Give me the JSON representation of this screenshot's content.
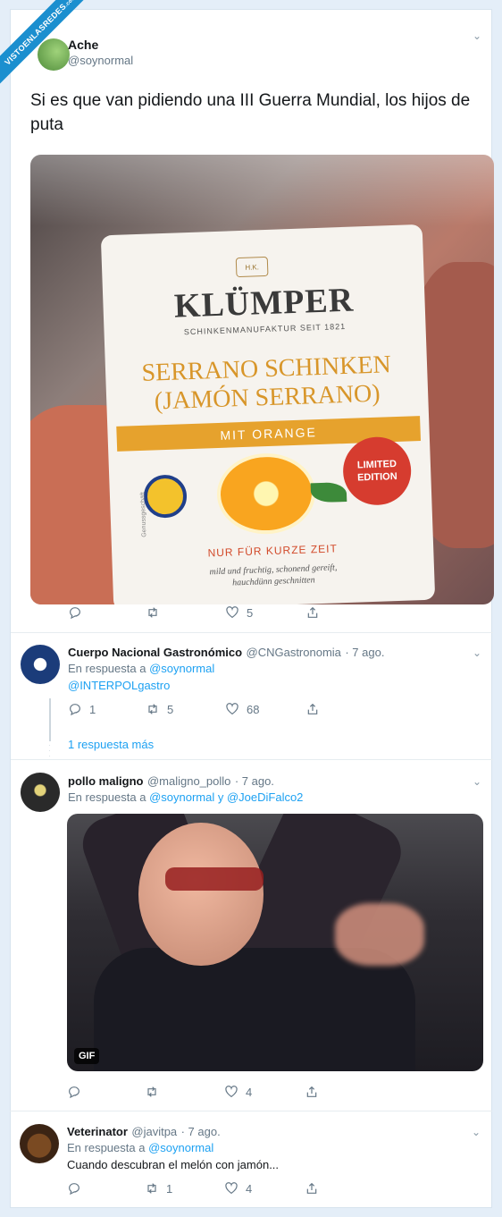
{
  "watermark": {
    "text": "VISTOENLASREDES",
    "sub": ".com"
  },
  "main_tweet": {
    "author_name": "Ache",
    "author_handle": "@soynormal",
    "text": "Si es que van pidiendo una III Guerra Mundial, los hijos de puta",
    "image": {
      "brand": "KLÜMPER",
      "crest": "H.K.",
      "subtitle": "SCHINKENMANUFAKTUR SEIT 1821",
      "title_line1": "SERRANO SCHINKEN",
      "title_line2": "(JAMÓN SERRANO)",
      "band": "MIT ORANGE",
      "badge_line1": "LIMITED",
      "badge_line2": "EDITION",
      "side_text": "Genussgeschäft",
      "nur": "NUR FÜR KURZE ZEIT",
      "mild_line1": "mild und fruchtig, schonend gereift,",
      "mild_line2": "hauchdünn geschnitten"
    },
    "likes": "5"
  },
  "replies": [
    {
      "name": "Cuerpo Nacional Gastronómico",
      "handle": "@CNGastronomia",
      "date": "· 7 ago.",
      "in_reply_prefix": "En respuesta a",
      "in_reply_to": "@soynormal",
      "text": "@INTERPOLgastro",
      "replies": "1",
      "retweets": "5",
      "likes": "68",
      "more": "1 respuesta más"
    },
    {
      "name": "pollo maligno",
      "handle": "@maligno_pollo",
      "date": "· 7 ago.",
      "in_reply_prefix": "En respuesta a",
      "in_reply_to": "@soynormal y @JoeDiFalco2",
      "gif_badge": "GIF",
      "likes": "4"
    },
    {
      "name": "Veterinator",
      "handle": "@javitpa",
      "date": "· 7 ago.",
      "in_reply_prefix": "En respuesta a",
      "in_reply_to": "@soynormal",
      "text": "Cuando descubran el melón con jamón...",
      "retweets": "1",
      "likes": "4"
    }
  ],
  "colors": {
    "link": "#1da1f2",
    "muted": "#657786",
    "background": "#e4eef8"
  }
}
